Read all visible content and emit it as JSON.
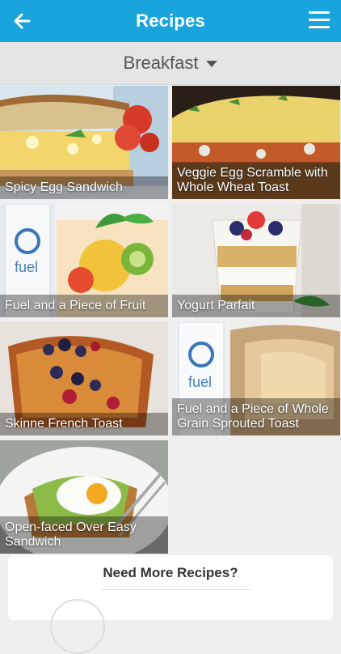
{
  "header": {
    "title": "Recipes",
    "back_icon": "arrow-left-icon",
    "menu_icon": "hamburger-icon",
    "color": "#1aa4dd"
  },
  "filter": {
    "selected": "Breakfast",
    "icon": "caret-down-icon"
  },
  "recipes": [
    {
      "name": "Spicy Egg Sandwich"
    },
    {
      "name": "Veggie Egg Scramble with Whole Wheat Toast"
    },
    {
      "name": "Fuel and a Piece of Fruit"
    },
    {
      "name": "Yogurt Parfait"
    },
    {
      "name": "Skinne French Toast"
    },
    {
      "name": "Fuel and a Piece of Whole Grain Sprouted Toast"
    },
    {
      "name": "Open-faced Over Easy Sandwich"
    }
  ],
  "more_card": {
    "title": "Need More Recipes?"
  }
}
